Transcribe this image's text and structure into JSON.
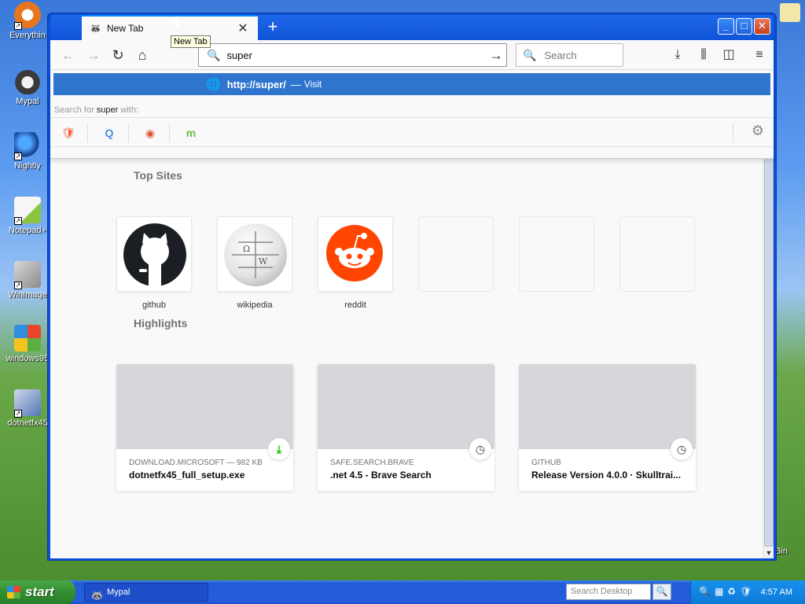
{
  "desktop": {
    "icons": [
      {
        "label": "Everythin",
        "icon": "everything-icon"
      },
      {
        "label": "Mypal",
        "icon": "mypal-icon"
      },
      {
        "label": "Nightly",
        "icon": "nightly-icon"
      },
      {
        "label": "Notepad+",
        "icon": "notepad-plus-icon"
      },
      {
        "label": "WinImage",
        "icon": "winimage-icon"
      },
      {
        "label": "windows95",
        "icon": "windows95-icon"
      },
      {
        "label": "dotnetfx45",
        "icon": "dotnetfx-icon"
      }
    ],
    "recycle_label": "Bin"
  },
  "browser": {
    "tab_title": "New Tab",
    "tooltip": "New Tab",
    "url_value": "super",
    "search_placeholder": "Search",
    "popup": {
      "url": "http://super/",
      "dash": "—",
      "action": "Visit",
      "search_for_prefix": "Search for ",
      "search_term": "super",
      "search_for_suffix": " with:"
    },
    "top_sites_title": "Top Sites",
    "top_sites": [
      {
        "label": "github"
      },
      {
        "label": "wikipedia"
      },
      {
        "label": "reddit"
      }
    ],
    "highlights_title": "Highlights",
    "highlights": [
      {
        "source": "DOWNLOAD.MICROSOFT — 982 KB",
        "title": "dotnetfx45_full_setup.exe",
        "badge": "download-icon"
      },
      {
        "source": "SAFE.SEARCH.BRAVE",
        "title": ".net 4.5 - Brave Search",
        "badge": "clock-icon"
      },
      {
        "source": "GITHUB",
        "title": "Release Version 4.0.0 · Skulltrai...",
        "badge": "clock-icon"
      }
    ]
  },
  "taskbar": {
    "start_label": "start",
    "task_label": "Mypal",
    "search_placeholder": "Search Desktop",
    "clock": "4:57 AM"
  }
}
